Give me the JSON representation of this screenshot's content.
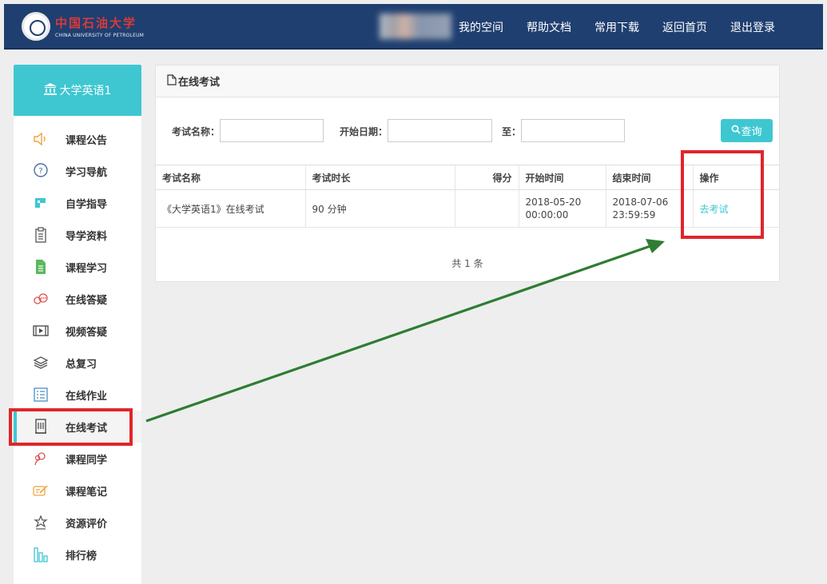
{
  "header": {
    "logo_cn": "中国石油大学",
    "logo_en": "CHINA UNIVERSITY OF PETROLEUM",
    "nav": [
      "我的空间",
      "帮助文档",
      "常用下载",
      "返回首页",
      "退出登录"
    ]
  },
  "sidebar": {
    "course": "大学英语1",
    "items": [
      {
        "label": "课程公告",
        "icon": "speaker-icon"
      },
      {
        "label": "学习导航",
        "icon": "question-icon"
      },
      {
        "label": "自学指导",
        "icon": "guide-icon"
      },
      {
        "label": "导学资料",
        "icon": "clipboard-icon"
      },
      {
        "label": "课程学习",
        "icon": "document-icon"
      },
      {
        "label": "在线答疑",
        "icon": "chat-icon"
      },
      {
        "label": "视频答疑",
        "icon": "video-icon"
      },
      {
        "label": "总复习",
        "icon": "layers-icon"
      },
      {
        "label": "在线作业",
        "icon": "list-icon"
      },
      {
        "label": "在线考试",
        "icon": "exam-icon",
        "active": true
      },
      {
        "label": "课程同学",
        "icon": "classmates-icon"
      },
      {
        "label": "课程笔记",
        "icon": "note-icon"
      },
      {
        "label": "资源评价",
        "icon": "rating-icon"
      },
      {
        "label": "排行榜",
        "icon": "bar-chart-icon"
      }
    ]
  },
  "main": {
    "title": "在线考试",
    "search": {
      "name_label": "考试名称：",
      "start_label": "开始日期：",
      "to_label": "至：",
      "name_value": "",
      "start_value": "",
      "end_value": "",
      "query_button": "查询"
    },
    "table": {
      "headers": [
        "考试名称",
        "考试时长",
        "得分",
        "开始时间",
        "结束时间",
        "操作"
      ],
      "rows": [
        {
          "name": "《大学英语1》在线考试",
          "duration": "90 分钟",
          "score": "",
          "start": "2018-05-20 00:00:00",
          "end": "2018-07-06 23:59:59",
          "action": "去考试"
        }
      ]
    },
    "total": "共 1 条"
  },
  "colors": {
    "header_bg": "#1f3f70",
    "accent": "#3ec7d1",
    "highlight": "#e0262b",
    "arrow": "#2e7d32"
  }
}
